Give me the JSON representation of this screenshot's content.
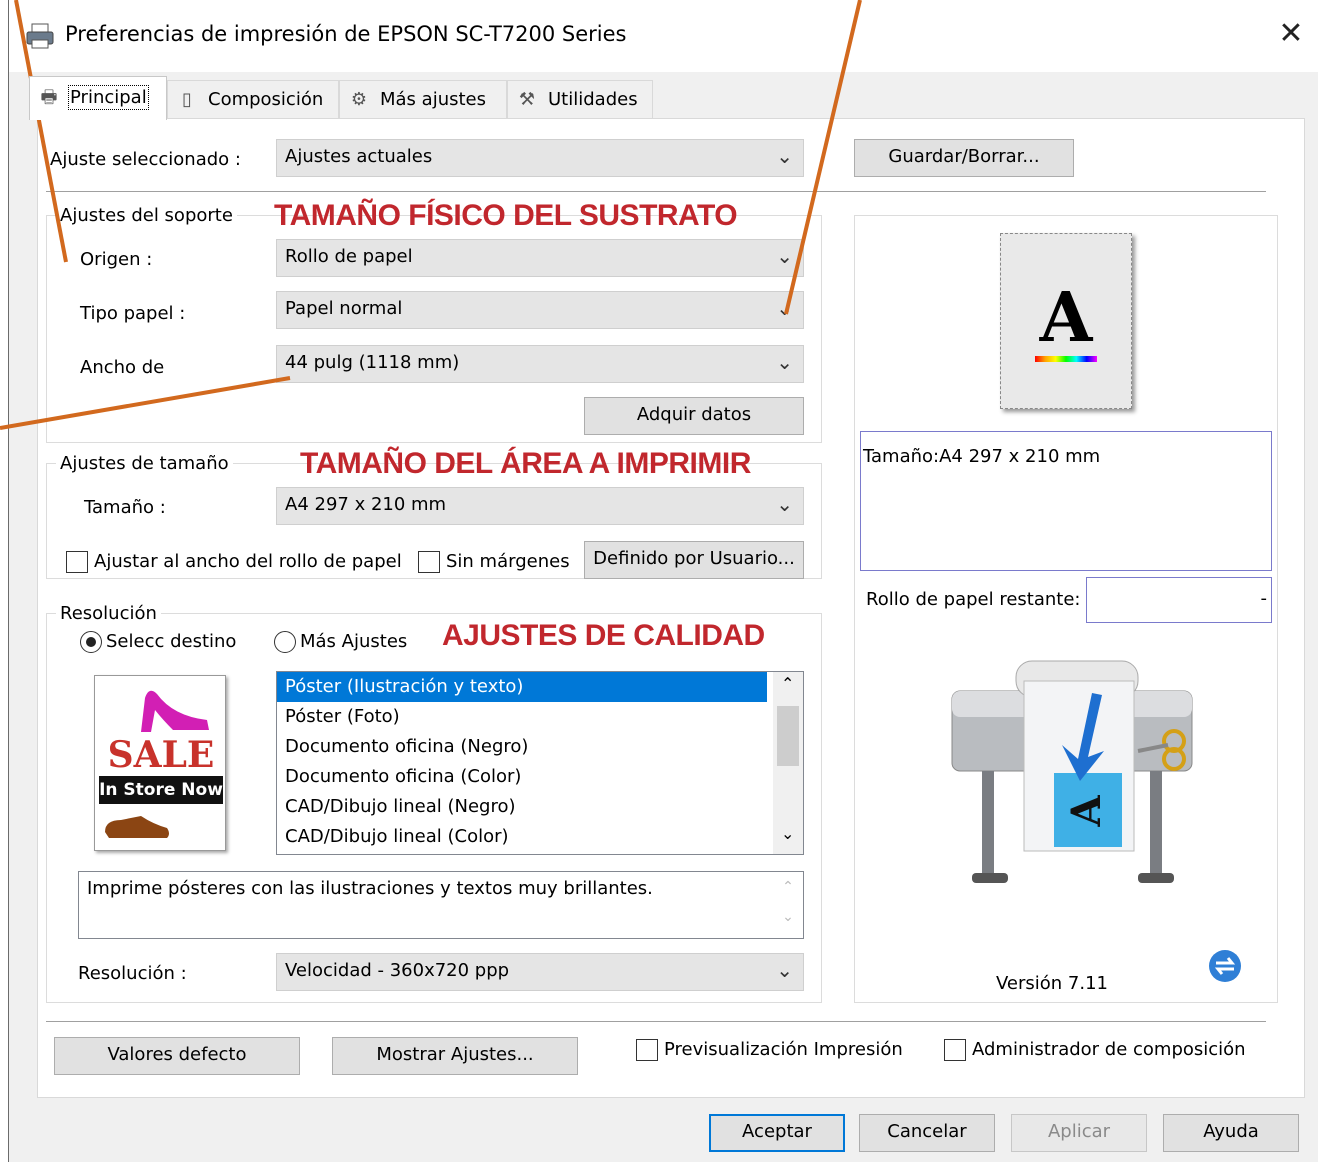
{
  "window": {
    "title": "Preferencias de impresión de EPSON SC-T7200 Series",
    "close_label": "✕"
  },
  "tabs": [
    {
      "label": "Principal",
      "icon": "printer-icon"
    },
    {
      "label": "Composición",
      "icon": "page-layout-icon"
    },
    {
      "label": "Más ajustes",
      "icon": "gear-icon"
    },
    {
      "label": "Utilidades",
      "icon": "wrench-icon"
    }
  ],
  "preset": {
    "label": "Ajuste seleccionado :",
    "value": "Ajustes actuales",
    "save_button": "Guardar/Borrar..."
  },
  "media": {
    "group_title": "Ajustes del soporte",
    "source_label": "Origen :",
    "source_value": "Rollo de papel",
    "paper_type_label": "Tipo papel :",
    "paper_type_value": "Papel normal",
    "width_label": "Ancho de",
    "width_value": "44 pulg (1118 mm)",
    "acquire_button": "Adquir datos"
  },
  "size": {
    "group_title": "Ajustes de tamaño",
    "size_label": "Tamaño :",
    "size_value": "A4 297 x 210 mm",
    "fit_roll_label": "Ajustar al ancho del rollo de papel",
    "fit_roll_checked": false,
    "borderless_label": "Sin márgenes",
    "borderless_checked": false,
    "user_defined_button": "Definido por Usuario..."
  },
  "resolution": {
    "group_title": "Resolución",
    "radio_target": "Selecc destino",
    "radio_more": "Más Ajustes",
    "selected_radio": "Selecc destino",
    "targets": [
      "Póster (Ilustración y texto)",
      "Póster (Foto)",
      "Documento oficina (Negro)",
      "Documento oficina (Color)",
      "CAD/Dibujo lineal (Negro)",
      "CAD/Dibujo lineal (Color)"
    ],
    "selected_index": 0,
    "description": "Imprime pósteres con las ilustraciones y textos muy brillantes.",
    "resolution_label": "Resolución :",
    "resolution_value": "Velocidad - 360x720 ppp",
    "thumbnail": {
      "sale_text": "SALE",
      "banner_text": "In Store Now"
    }
  },
  "preview": {
    "page_letter": "A",
    "size_info": "Tamaño:A4 297 x 210 mm",
    "roll_remaining_label": "Rollo de papel restante:",
    "roll_remaining_value": "-",
    "printer_sheet_letter": "A",
    "version": "Versión 7.11"
  },
  "annotations": {
    "physical_size": "TAMAÑO FÍSICO DEL SUSTRATO",
    "print_area": "TAMAÑO DEL ÁREA A IMPRIMIR",
    "quality": "AJUSTES DE CALIDAD",
    "arrow_color": "#d2691e",
    "text_color": "#c1272d"
  },
  "bottom": {
    "defaults_button": "Valores defecto",
    "show_settings_button": "Mostrar Ajustes...",
    "print_preview_label": "Previsualización Impresión",
    "layout_manager_label": "Administrador de composición",
    "ok": "Aceptar",
    "cancel": "Cancelar",
    "apply": "Aplicar",
    "help": "Ayuda"
  }
}
